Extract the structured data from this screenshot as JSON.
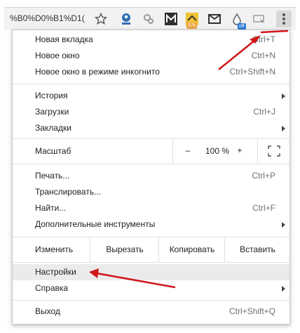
{
  "toolbar": {
    "url_text": "%B0%D0%B1%D1(",
    "star_icon": "star-icon",
    "badge_count": "57k",
    "badge_off": "off"
  },
  "menu": {
    "new_tab": {
      "label": "Новая вкладка",
      "shortcut": "Ctrl+T"
    },
    "new_window": {
      "label": "Новое окно",
      "shortcut": "Ctrl+N"
    },
    "incognito": {
      "label": "Новое окно в режиме инкогнито",
      "shortcut": "Ctrl+Shift+N"
    },
    "history": {
      "label": "История"
    },
    "downloads": {
      "label": "Загрузки",
      "shortcut": "Ctrl+J"
    },
    "bookmarks": {
      "label": "Закладки"
    },
    "zoom": {
      "label": "Масштаб",
      "minus": "–",
      "value": "100 %",
      "plus": "+"
    },
    "print": {
      "label": "Печать...",
      "shortcut": "Ctrl+P"
    },
    "cast": {
      "label": "Транслировать..."
    },
    "find": {
      "label": "Найти...",
      "shortcut": "Ctrl+F"
    },
    "more_tools": {
      "label": "Дополнительные инструменты"
    },
    "edit": {
      "label": "Изменить",
      "cut": "Вырезать",
      "copy": "Копировать",
      "paste": "Вставить"
    },
    "settings": {
      "label": "Настройки"
    },
    "help": {
      "label": "Справка"
    },
    "exit": {
      "label": "Выход",
      "shortcut": "Ctrl+Shift+Q"
    }
  },
  "colors": {
    "annotation": "#d0161b",
    "highlight": "#ebebeb"
  }
}
